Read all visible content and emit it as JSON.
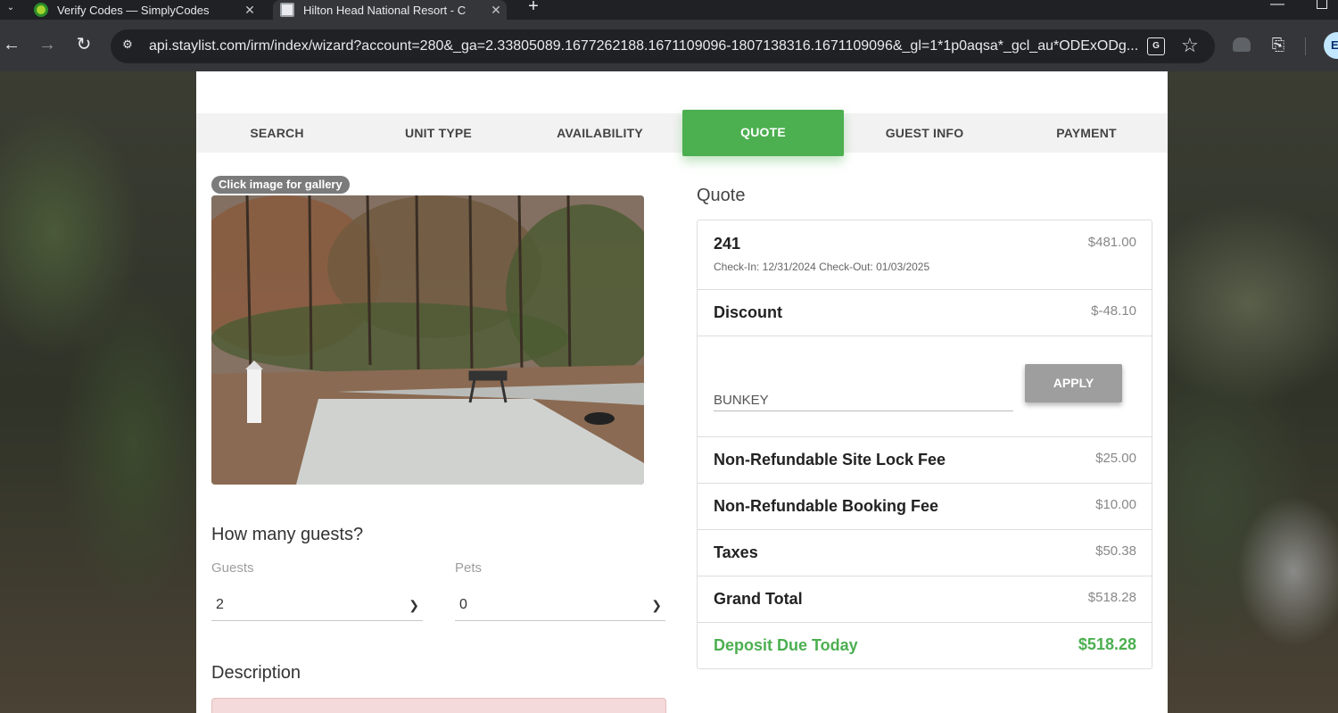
{
  "browser": {
    "tabs": [
      {
        "title": "Verify Codes — SimplyCodes",
        "favicon": "simplycodes-icon"
      },
      {
        "title": "Hilton Head National Resort - C",
        "favicon": "page-icon"
      }
    ],
    "url": "api.staylist.com/irm/index/wizard?account=280&_ga=2.33805089.1677262188.1671109096-1807138316.1671109096&_gl=1*1p0aqsa*_gcl_au*ODExODg...",
    "profile_initial": "E"
  },
  "steps": {
    "search": "SEARCH",
    "unit_type": "UNIT TYPE",
    "availability": "AVAILABILITY",
    "quote": "QUOTE",
    "guest_info": "GUEST INFO",
    "payment": "PAYMENT",
    "active": "QUOTE",
    "active_color": "#4caf50"
  },
  "left": {
    "gallery_hint": "Click image for gallery",
    "guests_heading": "How many guests?",
    "guests_label": "Guests",
    "guests_value": "2",
    "pets_label": "Pets",
    "pets_value": "0",
    "description_heading": "Description"
  },
  "quote": {
    "heading": "Quote",
    "unit": {
      "name": "241",
      "amount": "$481.00",
      "dates": "Check-In: 12/31/2024 Check-Out: 01/03/2025"
    },
    "discount": {
      "label": "Discount",
      "amount": "$-48.10"
    },
    "promo": {
      "value": "BUNKEY",
      "apply_label": "APPLY"
    },
    "site_lock_fee": {
      "label": "Non-Refundable Site Lock Fee",
      "amount": "$25.00"
    },
    "booking_fee": {
      "label": "Non-Refundable Booking Fee",
      "amount": "$10.00"
    },
    "taxes": {
      "label": "Taxes",
      "amount": "$50.38"
    },
    "grand_total": {
      "label": "Grand Total",
      "amount": "$518.28"
    },
    "deposit": {
      "label": "Deposit Due Today",
      "amount": "$518.28"
    }
  }
}
